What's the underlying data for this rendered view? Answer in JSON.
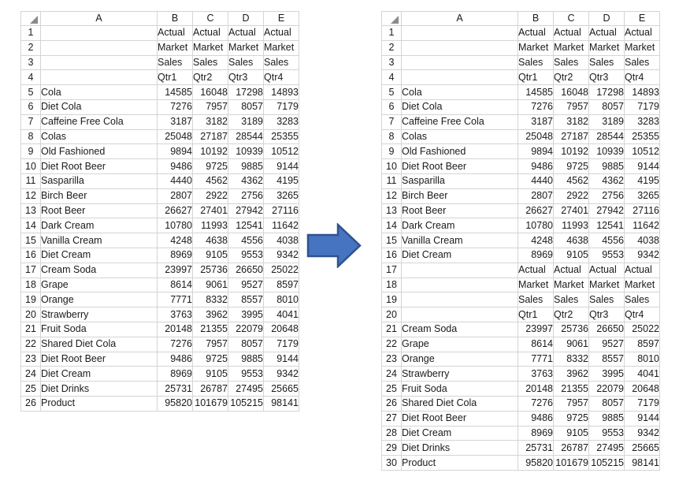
{
  "columns": [
    "A",
    "B",
    "C",
    "D",
    "E"
  ],
  "left_sheet": {
    "name": "before-spreadsheet",
    "row_count": 26,
    "rows": [
      {
        "n": "1",
        "a": "",
        "indent": 0,
        "b": "Actual",
        "c": "Actual",
        "d": "Actual",
        "e": "Actual",
        "text": true
      },
      {
        "n": "2",
        "a": "",
        "indent": 0,
        "b": "Market",
        "c": "Market",
        "d": "Market",
        "e": "Market",
        "text": true
      },
      {
        "n": "3",
        "a": "",
        "indent": 0,
        "b": "Sales",
        "c": "Sales",
        "d": "Sales",
        "e": "Sales",
        "text": true
      },
      {
        "n": "4",
        "a": "",
        "indent": 0,
        "b": "Qtr1",
        "c": "Qtr2",
        "d": "Qtr3",
        "e": "Qtr4",
        "text": true
      },
      {
        "n": "5",
        "a": "Cola",
        "indent": 2,
        "b": "14585",
        "c": "16048",
        "d": "17298",
        "e": "14893",
        "text": false
      },
      {
        "n": "6",
        "a": "Diet Cola",
        "indent": 2,
        "b": "7276",
        "c": "7957",
        "d": "8057",
        "e": "7179",
        "text": false
      },
      {
        "n": "7",
        "a": "Caffeine Free Cola",
        "indent": 2,
        "b": "3187",
        "c": "3182",
        "d": "3189",
        "e": "3283",
        "text": false
      },
      {
        "n": "8",
        "a": "Colas",
        "indent": 1,
        "b": "25048",
        "c": "27187",
        "d": "28544",
        "e": "25355",
        "text": false
      },
      {
        "n": "9",
        "a": "Old Fashioned",
        "indent": 2,
        "b": "9894",
        "c": "10192",
        "d": "10939",
        "e": "10512",
        "text": false
      },
      {
        "n": "10",
        "a": "Diet Root Beer",
        "indent": 2,
        "b": "9486",
        "c": "9725",
        "d": "9885",
        "e": "9144",
        "text": false
      },
      {
        "n": "11",
        "a": "Sasparilla",
        "indent": 2,
        "b": "4440",
        "c": "4562",
        "d": "4362",
        "e": "4195",
        "text": false
      },
      {
        "n": "12",
        "a": "Birch Beer",
        "indent": 2,
        "b": "2807",
        "c": "2922",
        "d": "2756",
        "e": "3265",
        "text": false
      },
      {
        "n": "13",
        "a": "Root Beer",
        "indent": 1,
        "b": "26627",
        "c": "27401",
        "d": "27942",
        "e": "27116",
        "text": false
      },
      {
        "n": "14",
        "a": "Dark Cream",
        "indent": 2,
        "b": "10780",
        "c": "11993",
        "d": "12541",
        "e": "11642",
        "text": false
      },
      {
        "n": "15",
        "a": "Vanilla Cream",
        "indent": 2,
        "b": "4248",
        "c": "4638",
        "d": "4556",
        "e": "4038",
        "text": false
      },
      {
        "n": "16",
        "a": "Diet Cream",
        "indent": 2,
        "b": "8969",
        "c": "9105",
        "d": "9553",
        "e": "9342",
        "text": false
      },
      {
        "n": "17",
        "a": "Cream Soda",
        "indent": 1,
        "b": "23997",
        "c": "25736",
        "d": "26650",
        "e": "25022",
        "text": false
      },
      {
        "n": "18",
        "a": "Grape",
        "indent": 2,
        "b": "8614",
        "c": "9061",
        "d": "9527",
        "e": "8597",
        "text": false
      },
      {
        "n": "19",
        "a": "Orange",
        "indent": 2,
        "b": "7771",
        "c": "8332",
        "d": "8557",
        "e": "8010",
        "text": false
      },
      {
        "n": "20",
        "a": "Strawberry",
        "indent": 2,
        "b": "3763",
        "c": "3962",
        "d": "3995",
        "e": "4041",
        "text": false
      },
      {
        "n": "21",
        "a": "Fruit Soda",
        "indent": 1,
        "b": "20148",
        "c": "21355",
        "d": "22079",
        "e": "20648",
        "text": false
      },
      {
        "n": "22",
        "a": "Shared Diet Cola",
        "indent": 2,
        "b": "7276",
        "c": "7957",
        "d": "8057",
        "e": "7179",
        "text": false
      },
      {
        "n": "23",
        "a": "Diet Root Beer",
        "indent": 2,
        "b": "9486",
        "c": "9725",
        "d": "9885",
        "e": "9144",
        "text": false
      },
      {
        "n": "24",
        "a": "Diet Cream",
        "indent": 2,
        "b": "8969",
        "c": "9105",
        "d": "9553",
        "e": "9342",
        "text": false
      },
      {
        "n": "25",
        "a": "Diet Drinks",
        "indent": 1,
        "b": "25731",
        "c": "26787",
        "d": "27495",
        "e": "25665",
        "text": false
      },
      {
        "n": "26",
        "a": "Product",
        "indent": 0,
        "b": "95820",
        "c": "101679",
        "d": "105215",
        "e": "98141",
        "text": false
      }
    ]
  },
  "right_sheet": {
    "name": "after-spreadsheet",
    "row_count": 30,
    "rows": [
      {
        "n": "1",
        "a": "",
        "indent": 0,
        "b": "Actual",
        "c": "Actual",
        "d": "Actual",
        "e": "Actual",
        "text": true
      },
      {
        "n": "2",
        "a": "",
        "indent": 0,
        "b": "Market",
        "c": "Market",
        "d": "Market",
        "e": "Market",
        "text": true
      },
      {
        "n": "3",
        "a": "",
        "indent": 0,
        "b": "Sales",
        "c": "Sales",
        "d": "Sales",
        "e": "Sales",
        "text": true
      },
      {
        "n": "4",
        "a": "",
        "indent": 0,
        "b": "Qtr1",
        "c": "Qtr2",
        "d": "Qtr3",
        "e": "Qtr4",
        "text": true
      },
      {
        "n": "5",
        "a": "Cola",
        "indent": 2,
        "b": "14585",
        "c": "16048",
        "d": "17298",
        "e": "14893",
        "text": false
      },
      {
        "n": "6",
        "a": "Diet Cola",
        "indent": 2,
        "b": "7276",
        "c": "7957",
        "d": "8057",
        "e": "7179",
        "text": false
      },
      {
        "n": "7",
        "a": "Caffeine Free Cola",
        "indent": 2,
        "b": "3187",
        "c": "3182",
        "d": "3189",
        "e": "3283",
        "text": false
      },
      {
        "n": "8",
        "a": "Colas",
        "indent": 1,
        "b": "25048",
        "c": "27187",
        "d": "28544",
        "e": "25355",
        "text": false
      },
      {
        "n": "9",
        "a": "Old Fashioned",
        "indent": 2,
        "b": "9894",
        "c": "10192",
        "d": "10939",
        "e": "10512",
        "text": false
      },
      {
        "n": "10",
        "a": "Diet Root Beer",
        "indent": 2,
        "b": "9486",
        "c": "9725",
        "d": "9885",
        "e": "9144",
        "text": false
      },
      {
        "n": "11",
        "a": "Sasparilla",
        "indent": 2,
        "b": "4440",
        "c": "4562",
        "d": "4362",
        "e": "4195",
        "text": false
      },
      {
        "n": "12",
        "a": "Birch Beer",
        "indent": 2,
        "b": "2807",
        "c": "2922",
        "d": "2756",
        "e": "3265",
        "text": false
      },
      {
        "n": "13",
        "a": "Root Beer",
        "indent": 1,
        "b": "26627",
        "c": "27401",
        "d": "27942",
        "e": "27116",
        "text": false
      },
      {
        "n": "14",
        "a": "Dark Cream",
        "indent": 2,
        "b": "10780",
        "c": "11993",
        "d": "12541",
        "e": "11642",
        "text": false
      },
      {
        "n": "15",
        "a": "Vanilla Cream",
        "indent": 2,
        "b": "4248",
        "c": "4638",
        "d": "4556",
        "e": "4038",
        "text": false
      },
      {
        "n": "16",
        "a": "Diet Cream",
        "indent": 2,
        "b": "8969",
        "c": "9105",
        "d": "9553",
        "e": "9342",
        "text": false
      },
      {
        "n": "17",
        "a": "",
        "indent": 0,
        "b": "Actual",
        "c": "Actual",
        "d": "Actual",
        "e": "Actual",
        "text": true
      },
      {
        "n": "18",
        "a": "",
        "indent": 0,
        "b": "Market",
        "c": "Market",
        "d": "Market",
        "e": "Market",
        "text": true
      },
      {
        "n": "19",
        "a": "",
        "indent": 0,
        "b": "Sales",
        "c": "Sales",
        "d": "Sales",
        "e": "Sales",
        "text": true
      },
      {
        "n": "20",
        "a": "",
        "indent": 0,
        "b": "Qtr1",
        "c": "Qtr2",
        "d": "Qtr3",
        "e": "Qtr4",
        "text": true
      },
      {
        "n": "21",
        "a": "Cream Soda",
        "indent": 1,
        "b": "23997",
        "c": "25736",
        "d": "26650",
        "e": "25022",
        "text": false
      },
      {
        "n": "22",
        "a": "Grape",
        "indent": 2,
        "b": "8614",
        "c": "9061",
        "d": "9527",
        "e": "8597",
        "text": false
      },
      {
        "n": "23",
        "a": "Orange",
        "indent": 2,
        "b": "7771",
        "c": "8332",
        "d": "8557",
        "e": "8010",
        "text": false
      },
      {
        "n": "24",
        "a": "Strawberry",
        "indent": 2,
        "b": "3763",
        "c": "3962",
        "d": "3995",
        "e": "4041",
        "text": false
      },
      {
        "n": "25",
        "a": "Fruit Soda",
        "indent": 1,
        "b": "20148",
        "c": "21355",
        "d": "22079",
        "e": "20648",
        "text": false
      },
      {
        "n": "26",
        "a": "Shared Diet Cola",
        "indent": 2,
        "b": "7276",
        "c": "7957",
        "d": "8057",
        "e": "7179",
        "text": false
      },
      {
        "n": "27",
        "a": "Diet Root Beer",
        "indent": 2,
        "b": "9486",
        "c": "9725",
        "d": "9885",
        "e": "9144",
        "text": false
      },
      {
        "n": "28",
        "a": "Diet Cream",
        "indent": 2,
        "b": "8969",
        "c": "9105",
        "d": "9553",
        "e": "9342",
        "text": false
      },
      {
        "n": "29",
        "a": "Diet Drinks",
        "indent": 1,
        "b": "25731",
        "c": "26787",
        "d": "27495",
        "e": "25665",
        "text": false
      },
      {
        "n": "30",
        "a": "Product",
        "indent": 0,
        "b": "95820",
        "c": "101679",
        "d": "105215",
        "e": "98141",
        "text": false
      }
    ]
  },
  "arrow": {
    "name": "right-arrow-icon",
    "direction": "right",
    "fill": "#4674C1",
    "stroke": "#2F528F"
  }
}
